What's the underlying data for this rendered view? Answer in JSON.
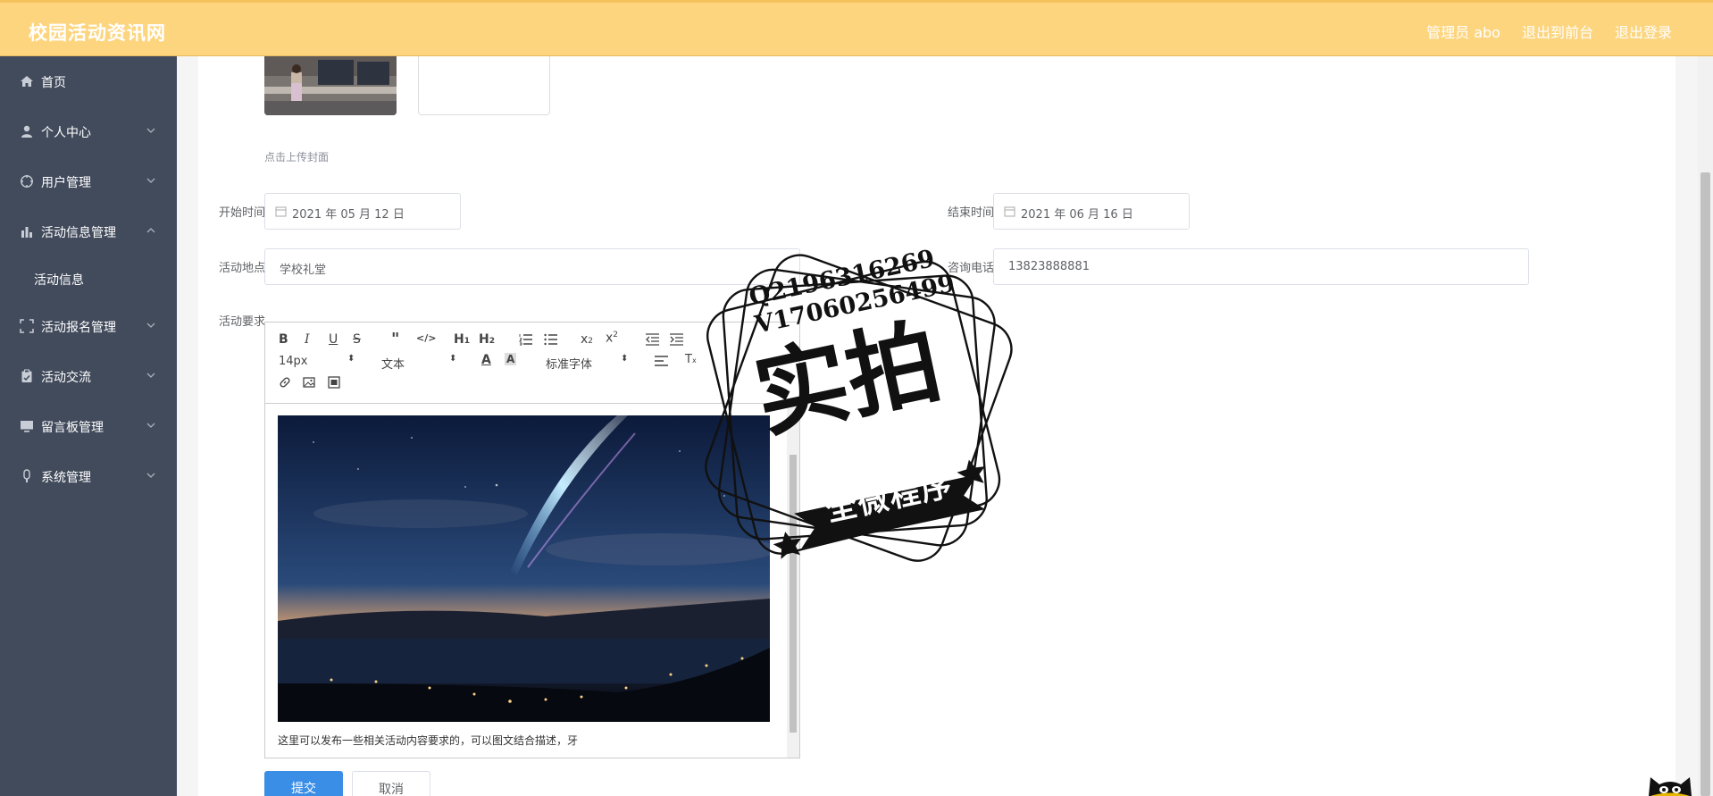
{
  "header": {
    "brand": "校园活动资讯网",
    "user": "管理员 abo",
    "to_front": "退出到前台",
    "logout": "退出登录"
  },
  "sidebar": {
    "items": [
      {
        "label": "首页",
        "icon": "home-icon"
      },
      {
        "label": "个人中心",
        "icon": "user-icon"
      },
      {
        "label": "用户管理",
        "icon": "users-icon"
      },
      {
        "label": "活动信息管理",
        "icon": "bar-chart-icon"
      },
      {
        "label": "活动报名管理",
        "icon": "scan-icon"
      },
      {
        "label": "活动交流",
        "icon": "clipboard-icon"
      },
      {
        "label": "留言板管理",
        "icon": "monitor-icon"
      },
      {
        "label": "系统管理",
        "icon": "settings-icon"
      }
    ],
    "sub_item": "活动信息"
  },
  "form": {
    "upload_hint": "点击上传封面",
    "start_label": "开始时间",
    "start_value": "2021 年 05 月 12 日",
    "end_label": "结束时间",
    "end_value": "2021 年 06 月 16 日",
    "location_label": "活动地点",
    "location_value": "学校礼堂",
    "phone_label": "咨询电话",
    "phone_value": "13823888881",
    "req_label": "活动要求"
  },
  "editor": {
    "font_size": "14px",
    "text_type": "文本",
    "font_family": "标准字体",
    "content": "这里可以发布一些相关活动内容要求的，可以图文结合描述，牙"
  },
  "buttons": {
    "submit": "提交",
    "cancel": "取消"
  },
  "watermark": {
    "line1": "Q2196316269",
    "line2": "V17060256499",
    "big": "实拍",
    "banner": "全微程序"
  }
}
